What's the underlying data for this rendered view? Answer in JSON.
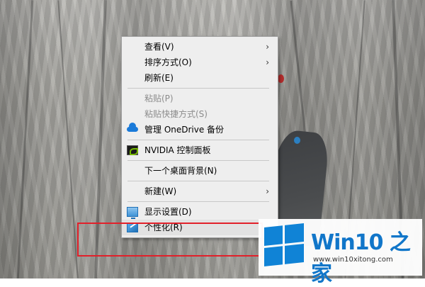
{
  "context_menu": {
    "items": [
      {
        "label": "查看(V)",
        "submenu": true
      },
      {
        "label": "排序方式(O)",
        "submenu": true
      },
      {
        "label": "刷新(E)"
      },
      {
        "label": "粘贴(P)",
        "disabled": true
      },
      {
        "label": "粘贴快捷方式(S)",
        "disabled": true
      },
      {
        "label": "管理 OneDrive 备份",
        "icon": "onedrive-icon"
      },
      {
        "label": "NVIDIA 控制面板",
        "icon": "nvidia-icon"
      },
      {
        "label": "下一个桌面背景(N)"
      },
      {
        "label": "新建(W)",
        "submenu": true
      },
      {
        "label": "显示设置(D)",
        "icon": "display-settings-icon"
      },
      {
        "label": "个性化(R)",
        "icon": "personalize-icon",
        "selected": true
      }
    ],
    "submenu_arrow": "›"
  },
  "watermark": {
    "title": "Win10 之家",
    "url": "www.win10xitong.com"
  },
  "colors": {
    "highlight_border": "#e2202a",
    "windows_blue": "#1083d6",
    "menu_background": "#eeeeee"
  }
}
